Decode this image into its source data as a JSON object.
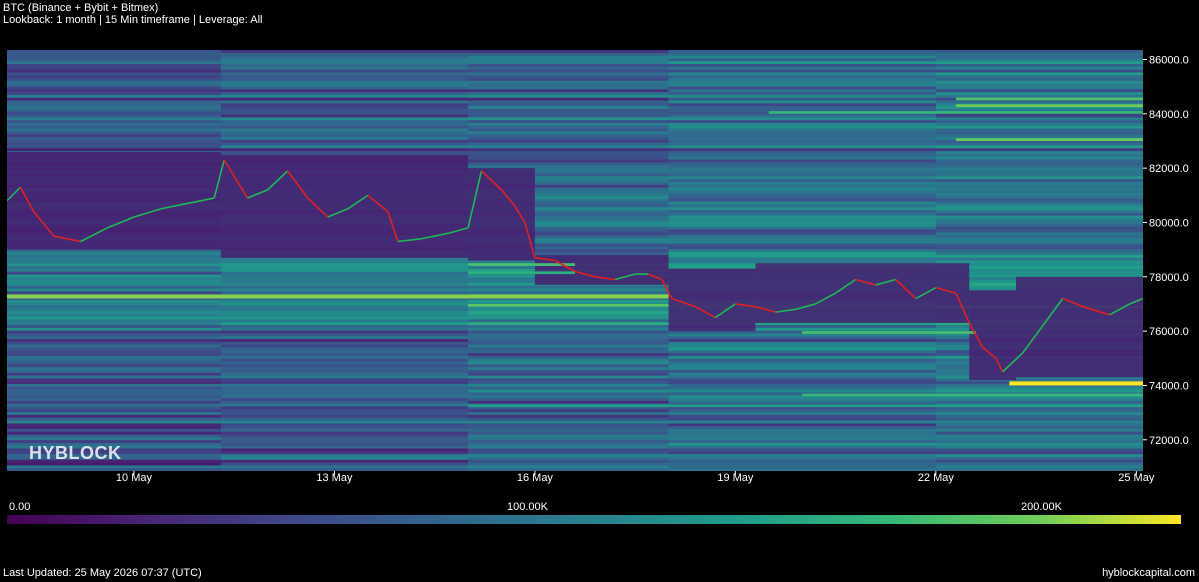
{
  "header": {
    "title": "BTC (Binance + Bybit + Bitmex)",
    "subtitle": "Lookback: 1 month | 15 Min timeframe | Leverage: All"
  },
  "watermark": "HYBLOCK",
  "footer": {
    "last_updated": "Last Updated: 25 May 2026 07:37 (UTC)",
    "site": "hyblockcapital.com"
  },
  "colorbar": {
    "labels": [
      "0.00",
      "100.00K",
      "200.00K"
    ],
    "min": 0,
    "max": 240000,
    "colormap": "viridis"
  },
  "chart_data": {
    "type": "heatmap",
    "title": "BTC (Binance + Bybit + Bitmex)",
    "x_tick_labels": [
      "10 May",
      "13 May",
      "16 May",
      "19 May",
      "22 May",
      "25 May"
    ],
    "y_tick_labels": [
      "86000.0",
      "84000.0",
      "82000.0",
      "80000.0",
      "78000.0",
      "76000.0",
      "74000.0",
      "72000.0"
    ],
    "ylim": [
      70850,
      86350
    ],
    "x_range_days": [
      8.1,
      25.1
    ],
    "price_series": {
      "interval": "15m",
      "up_color": "#1db954",
      "down_color": "#e02020",
      "close_path": [
        [
          8.1,
          80800
        ],
        [
          8.3,
          81300
        ],
        [
          8.5,
          80400
        ],
        [
          8.8,
          79500
        ],
        [
          9.2,
          79300
        ],
        [
          9.6,
          79800
        ],
        [
          10.0,
          80200
        ],
        [
          10.4,
          80500
        ],
        [
          10.8,
          80700
        ],
        [
          11.2,
          80900
        ],
        [
          11.35,
          82300
        ],
        [
          11.7,
          80900
        ],
        [
          12.0,
          81200
        ],
        [
          12.3,
          81900
        ],
        [
          12.6,
          80900
        ],
        [
          12.9,
          80200
        ],
        [
          13.2,
          80500
        ],
        [
          13.5,
          81000
        ],
        [
          13.8,
          80400
        ],
        [
          13.95,
          79300
        ],
        [
          14.3,
          79400
        ],
        [
          14.7,
          79600
        ],
        [
          15.0,
          79800
        ],
        [
          15.2,
          81900
        ],
        [
          15.5,
          81200
        ],
        [
          15.7,
          80600
        ],
        [
          15.85,
          80000
        ],
        [
          16.0,
          78700
        ],
        [
          16.3,
          78600
        ],
        [
          16.6,
          78200
        ],
        [
          16.9,
          78000
        ],
        [
          17.2,
          77900
        ],
        [
          17.5,
          78100
        ],
        [
          17.7,
          78100
        ],
        [
          17.9,
          77900
        ],
        [
          18.05,
          77200
        ],
        [
          18.4,
          76900
        ],
        [
          18.7,
          76500
        ],
        [
          19.0,
          77000
        ],
        [
          19.3,
          76900
        ],
        [
          19.6,
          76700
        ],
        [
          19.9,
          76800
        ],
        [
          20.2,
          77000
        ],
        [
          20.5,
          77400
        ],
        [
          20.8,
          77900
        ],
        [
          21.1,
          77700
        ],
        [
          21.4,
          77900
        ],
        [
          21.7,
          77200
        ],
        [
          22.0,
          77600
        ],
        [
          22.3,
          77400
        ],
        [
          22.5,
          76300
        ],
        [
          22.7,
          75400
        ],
        [
          22.9,
          75000
        ],
        [
          23.0,
          74500
        ],
        [
          23.3,
          75200
        ],
        [
          23.6,
          76200
        ],
        [
          23.9,
          77200
        ],
        [
          24.2,
          76900
        ],
        [
          24.6,
          76600
        ],
        [
          24.9,
          77000
        ],
        [
          25.1,
          77200
        ]
      ]
    },
    "liquidation_bands": [
      {
        "price_low": 84500,
        "price_high": 84600,
        "day_start": 22.3,
        "day_end": 25.1,
        "value": 195000
      },
      {
        "price_low": 84250,
        "price_high": 84350,
        "day_start": 22.3,
        "day_end": 25.1,
        "value": 210000
      },
      {
        "price_low": 84000,
        "price_high": 84100,
        "day_start": 19.5,
        "day_end": 25.1,
        "value": 180000
      },
      {
        "price_low": 83000,
        "price_high": 83100,
        "day_start": 22.3,
        "day_end": 25.1,
        "value": 205000
      },
      {
        "price_low": 78400,
        "price_high": 78500,
        "day_start": 15.0,
        "day_end": 16.6,
        "value": 190000
      },
      {
        "price_low": 78100,
        "price_high": 78200,
        "day_start": 15.0,
        "day_end": 16.6,
        "value": 170000
      },
      {
        "price_low": 77200,
        "price_high": 77350,
        "day_start": 8.1,
        "day_end": 18.0,
        "value": 215000
      },
      {
        "price_low": 76900,
        "price_high": 77000,
        "day_start": 15.0,
        "day_end": 18.0,
        "value": 200000
      },
      {
        "price_low": 75900,
        "price_high": 76000,
        "day_start": 20.0,
        "day_end": 22.6,
        "value": 190000
      },
      {
        "price_low": 74000,
        "price_high": 74150,
        "day_start": 23.1,
        "day_end": 25.1,
        "value": 240000
      },
      {
        "price_low": 73600,
        "price_high": 73700,
        "day_start": 20.0,
        "day_end": 25.1,
        "value": 180000
      },
      {
        "price_low": 73200,
        "price_high": 73300,
        "day_start": 15.0,
        "day_end": 25.1,
        "value": 150000
      },
      {
        "price_low": 72600,
        "price_high": 72700,
        "day_start": 8.1,
        "day_end": 25.1,
        "value": 120000
      }
    ]
  }
}
